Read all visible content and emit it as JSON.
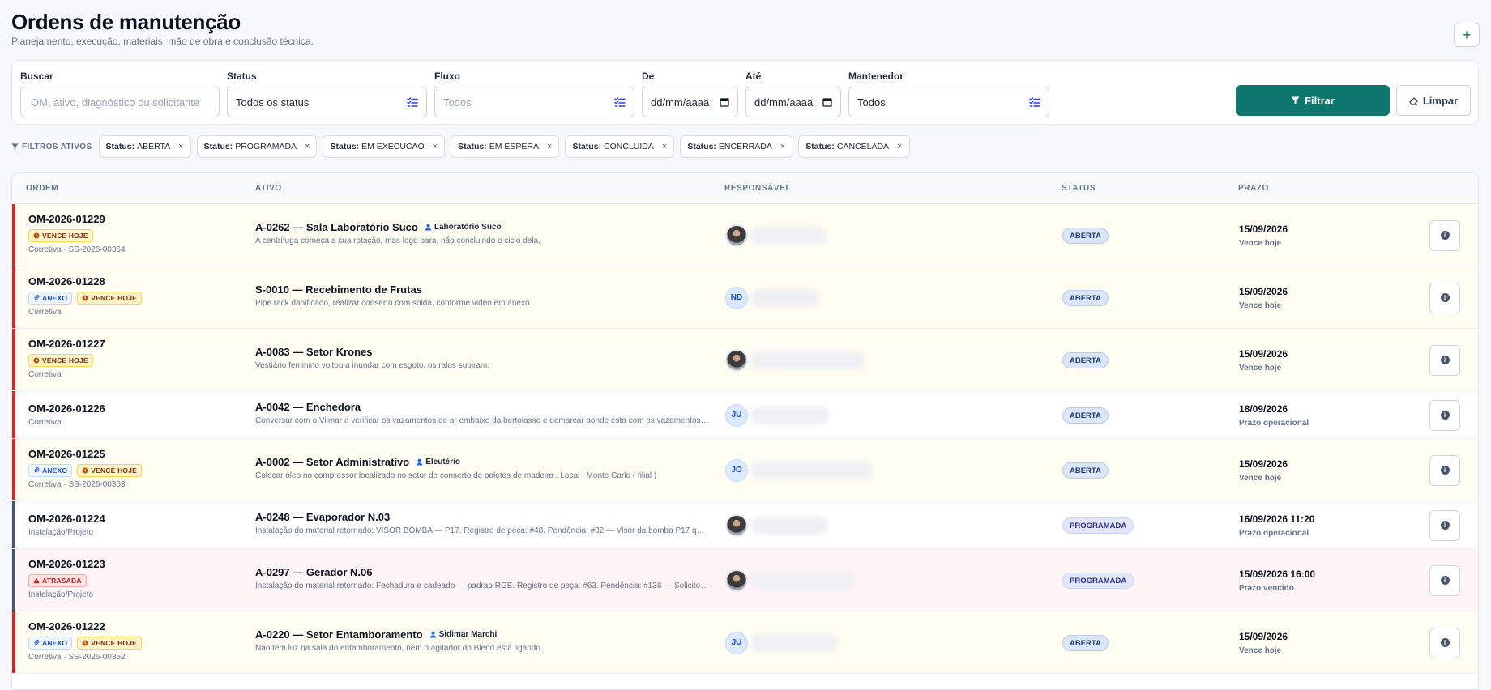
{
  "header": {
    "title": "Ordens de manutenção",
    "subtitle": "Planejamento, execução, materiais, mão de obra e conclusão técnica.",
    "add_label": "+"
  },
  "filters": {
    "search": {
      "label": "Buscar",
      "placeholder": "OM, ativo, diagnóstico ou solicitante"
    },
    "status": {
      "label": "Status",
      "value": "Todos os status"
    },
    "fluxo": {
      "label": "Fluxo",
      "value": "Todos"
    },
    "de": {
      "label": "De",
      "value": "dd/mm/aaaa"
    },
    "ate": {
      "label": "Até",
      "value": "dd/mm/aaaa"
    },
    "mantenedor": {
      "label": "Mantenedor",
      "value": "Todos"
    },
    "filter_button": "Filtrar",
    "clear_button": "Limpar"
  },
  "active_filters": {
    "label": "FILTROS ATIVOS",
    "key": "Status:",
    "chips": [
      "ABERTA",
      "PROGRAMADA",
      "EM EXECUCAO",
      "EM ESPERA",
      "CONCLUIDA",
      "ENCERRADA",
      "CANCELADA"
    ],
    "remove_symbol": "×"
  },
  "table": {
    "columns": {
      "ordem": "ORDEM",
      "ativo": "ATIVO",
      "responsavel": "RESPONSÁVEL",
      "status": "STATUS",
      "prazo": "PRAZO"
    },
    "badge_labels": {
      "anexo": "ANEXO",
      "vence": "VENCE HOJE",
      "atrasada": "ATRASADA"
    },
    "rows": [
      {
        "id": "OM-2026-01229",
        "meta": "Corretiva · SS-2026-00364",
        "ativo": "A-0262 — Sala Laboratório Suco",
        "person": "Laboratório Suco",
        "desc": "A centrífuga começa a sua rotação, mas logo para, não concluindo o ciclo dela.",
        "avatar": "",
        "status": "ABERTA",
        "prazo": "15/09/2026",
        "prazo_sub": "Vence hoje"
      },
      {
        "id": "OM-2026-01228",
        "meta": "Corretiva",
        "ativo": "S-0010 — Recebimento de Frutas",
        "person": "",
        "desc": "Pipe rack danificado, realizar conserto com solda, conforme video em anexo",
        "avatar": "ND",
        "status": "ABERTA",
        "prazo": "15/09/2026",
        "prazo_sub": "Vence hoje"
      },
      {
        "id": "OM-2026-01227",
        "meta": "Corretiva",
        "ativo": "A-0083 — Setor Krones",
        "person": "",
        "desc": "Vestiário feminino voltou a inundar com esgoto, os ralos subiram.",
        "avatar": "",
        "status": "ABERTA",
        "prazo": "15/09/2026",
        "prazo_sub": "Vence hoje"
      },
      {
        "id": "OM-2026-01226",
        "meta": "Corretiva",
        "ativo": "A-0042 — Enchedora",
        "person": "",
        "desc": "Conversar com o Vilmar e verificar os vazamentos de ar embaixo da bertolasso e demarcar aonde esta com os vazamentos, ...",
        "avatar": "JU",
        "status": "ABERTA",
        "prazo": "18/09/2026",
        "prazo_sub": "Prazo operacional"
      },
      {
        "id": "OM-2026-01225",
        "meta": "Corretiva · SS-2026-00363",
        "ativo": "A-0002 — Setor Administrativo",
        "person": "Eleutério",
        "desc": "Colocar óleo no compressor localizado no setor de conserto de paletes de madeira . Local : Monte Carlo ( filial )",
        "avatar": "JO",
        "status": "ABERTA",
        "prazo": "15/09/2026",
        "prazo_sub": "Vence hoje"
      },
      {
        "id": "OM-2026-01224",
        "meta": "Instalação/Projeto",
        "ativo": "A-0248 — Evaporador N.03",
        "person": "",
        "desc": "Instalação do material retornado: VISOR BOMBA — P17. Registro de peça: #48. Pendência: #82 — Visor da bomba P17 que ...",
        "avatar": "",
        "status": "PROGRAMADA",
        "prazo": "16/09/2026 11:20",
        "prazo_sub": "Prazo operacional"
      },
      {
        "id": "OM-2026-01223",
        "meta": "Instalação/Projeto",
        "ativo": "A-0297 — Gerador N.06",
        "person": "",
        "desc": "Instalação do material retornado: Fechadura e cadeado — padrao RGE. Registro de peça: #63. Pendência: #138 — Solicito co...",
        "avatar": "",
        "status": "PROGRAMADA",
        "prazo": "15/09/2026 16:00",
        "prazo_sub": "Prazo vencido"
      },
      {
        "id": "OM-2026-01222",
        "meta": "Corretiva · SS-2026-00352",
        "ativo": "A-0220 — Setor Entamboramento",
        "person": "Sidimar Marchi",
        "desc": "Não tem luz na sala do entamboramento, nem o agitador do Blend está ligando.",
        "avatar": "JU",
        "status": "ABERTA",
        "prazo": "15/09/2026",
        "prazo_sub": "Vence hoje"
      }
    ]
  }
}
